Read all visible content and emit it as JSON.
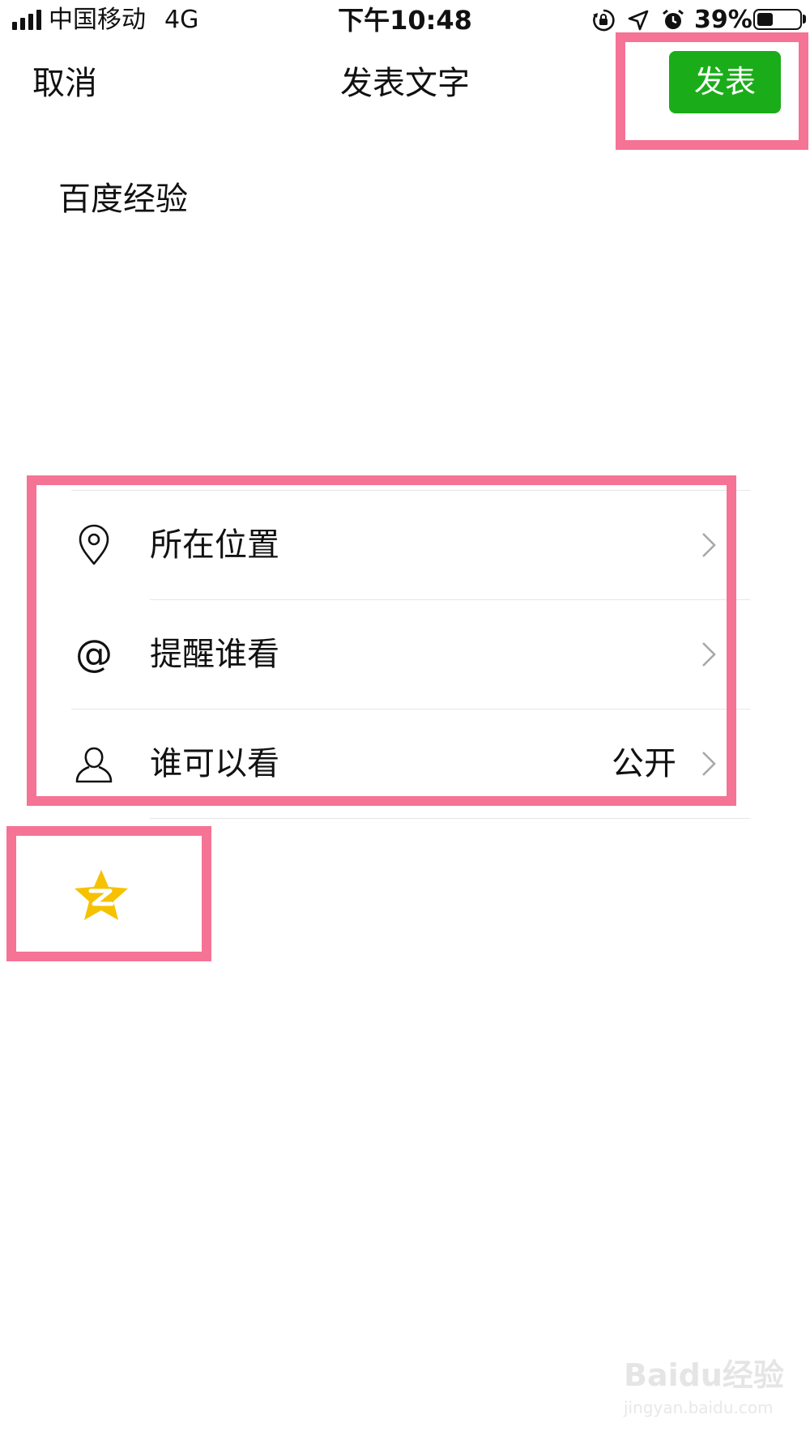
{
  "status_bar": {
    "carrier": "中国移动",
    "network": "4G",
    "time": "下午10:48",
    "battery_percent": "39%",
    "battery_level": 0.39,
    "icons": [
      "orientation-lock-icon",
      "location-arrow-icon",
      "alarm-icon"
    ]
  },
  "nav": {
    "cancel_label": "取消",
    "title": "发表文字",
    "publish_label": "发表"
  },
  "post": {
    "text": "百度经验"
  },
  "options": [
    {
      "icon": "location-pin-icon",
      "label": "所在位置",
      "value": ""
    },
    {
      "icon": "at-icon",
      "label": "提醒谁看",
      "value": ""
    },
    {
      "icon": "person-icon",
      "label": "谁可以看",
      "value": "公开"
    }
  ],
  "share": {
    "qzone_icon": "qzone-star-icon"
  },
  "watermark": {
    "brand": "Baidu经验",
    "url": "jingyan.baidu.com"
  },
  "colors": {
    "publish_green": "#1aad19",
    "highlight_pink": "#f57395",
    "qzone_yellow": "#f6c101"
  }
}
